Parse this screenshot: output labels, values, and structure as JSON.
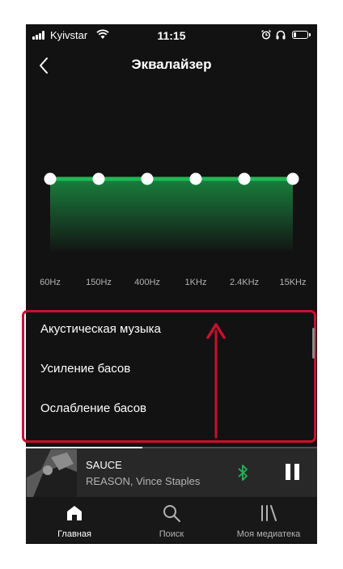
{
  "status_bar": {
    "carrier": "Kyivstar",
    "time": "11:15",
    "battery_level": 0.2,
    "icons": [
      "signal-icon",
      "wifi-icon",
      "alarm-icon",
      "headphones-icon",
      "battery-icon"
    ]
  },
  "header": {
    "title": "Эквалайзер",
    "back_icon": "chevron-left-icon"
  },
  "equalizer": {
    "bands": [
      {
        "label": "60Hz",
        "gain": 0
      },
      {
        "label": "150Hz",
        "gain": 0
      },
      {
        "label": "400Hz",
        "gain": 0
      },
      {
        "label": "1KHz",
        "gain": 0
      },
      {
        "label": "2.4KHz",
        "gain": 0
      },
      {
        "label": "15KHz",
        "gain": 0
      }
    ],
    "accent_color": "#1db954"
  },
  "presets": {
    "items": [
      {
        "label": "Акустическая музыка"
      },
      {
        "label": "Усиление басов"
      },
      {
        "label": "Ослабление басов"
      }
    ],
    "highlight_color": "#c8102e"
  },
  "now_playing": {
    "title": "SAUCE",
    "artist": "REASON, Vince Staples",
    "bluetooth_icon": "bluetooth-icon",
    "pause_icon": "pause-icon"
  },
  "bottom_nav": {
    "items": [
      {
        "label": "Главная",
        "icon": "home-icon",
        "active": true
      },
      {
        "label": "Поиск",
        "icon": "search-icon",
        "active": false
      },
      {
        "label": "Моя медиатека",
        "icon": "library-icon",
        "active": false
      }
    ]
  }
}
